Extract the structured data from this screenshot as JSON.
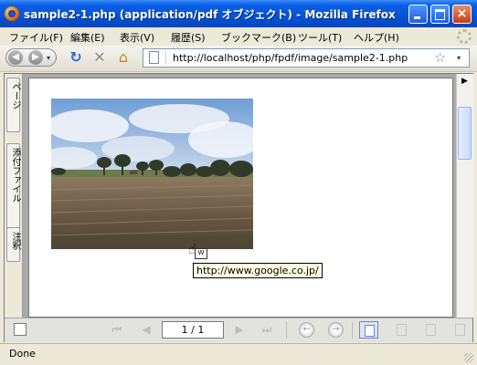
{
  "window": {
    "title": "sample2-1.php (application/pdf オブジェクト) - Mozilla Firefox",
    "close_glyph": "×"
  },
  "menubar": {
    "items": [
      "ファイル(F)",
      "編集(E)",
      "表示(V)",
      "履歴(S)",
      "ブックマーク(B)",
      "ツール(T)",
      "ヘルプ(H)"
    ]
  },
  "navbar": {
    "back_glyph": "◀",
    "forward_glyph": "▶",
    "dropdown_glyph": "▾",
    "reload_glyph": "↻",
    "stop_glyph": "✕",
    "home_glyph": "⌂",
    "url": "http://localhost/php/fpdf/image/sample2-1.php",
    "bookmark_glyph": "☆"
  },
  "side_panel": {
    "tabs": [
      "ページ",
      "添付ファイル",
      "注釈"
    ]
  },
  "document": {
    "tooltip": "http://www.google.co.jp/",
    "cursor_glyph": "☝"
  },
  "pdf_toolbar": {
    "page_indicator": "1 / 1",
    "first_glyph": "⏮",
    "prev_glyph": "◀",
    "next_glyph": "▶",
    "last_glyph": "⏭",
    "back_view_glyph": "←",
    "forward_view_glyph": "→"
  },
  "scrollbar": {
    "up_glyph": "▶"
  },
  "status": {
    "text": "Done"
  },
  "icons": {
    "app": "firefox-icon",
    "reload": "reload-icon",
    "stop": "stop-icon",
    "home": "home-icon",
    "page": "page-icon",
    "bookmark": "star-icon"
  }
}
